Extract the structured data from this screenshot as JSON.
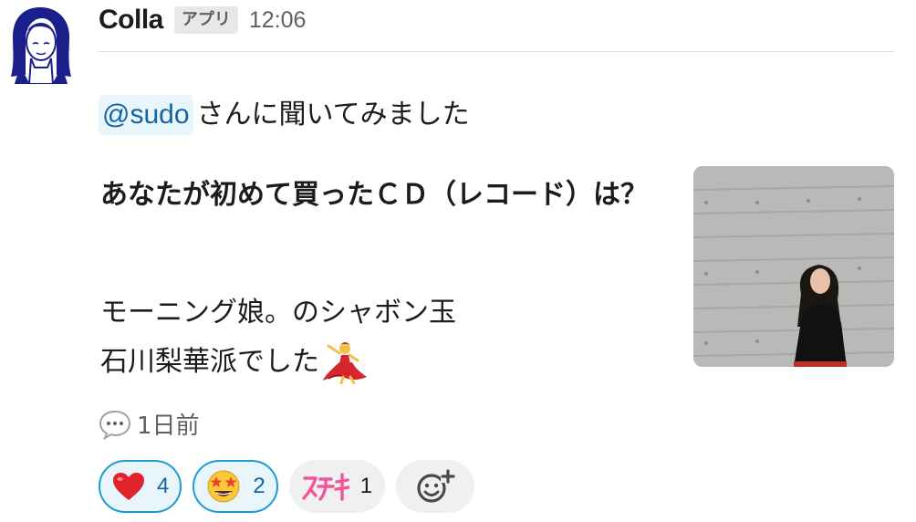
{
  "message": {
    "sender": "Colla",
    "badge": "アプリ",
    "time": "12:06",
    "mention": "@sudo",
    "intro_text": "さんに聞いてみました",
    "question": "あなたが初めて買ったＣＤ（レコード）は？",
    "answer_lines": [
      "モーニング娘。のシャボン玉",
      "石川梨華派でした"
    ],
    "thread_text": "1日前",
    "reactions": [
      {
        "emoji": "heart",
        "count": "4",
        "active": true
      },
      {
        "emoji": "star-struck",
        "count": "2",
        "active": true
      },
      {
        "emoji": "sutekisticker",
        "label": "ステキ",
        "count": "1",
        "active": false
      }
    ]
  },
  "colors": {
    "mention_bg": "#e8f5fa",
    "mention_text": "#1264a3",
    "reaction_active_border": "#1d9bd1",
    "reaction_inactive_bg": "#f0f0f0",
    "avatar_hair": "#1a1f8c"
  }
}
